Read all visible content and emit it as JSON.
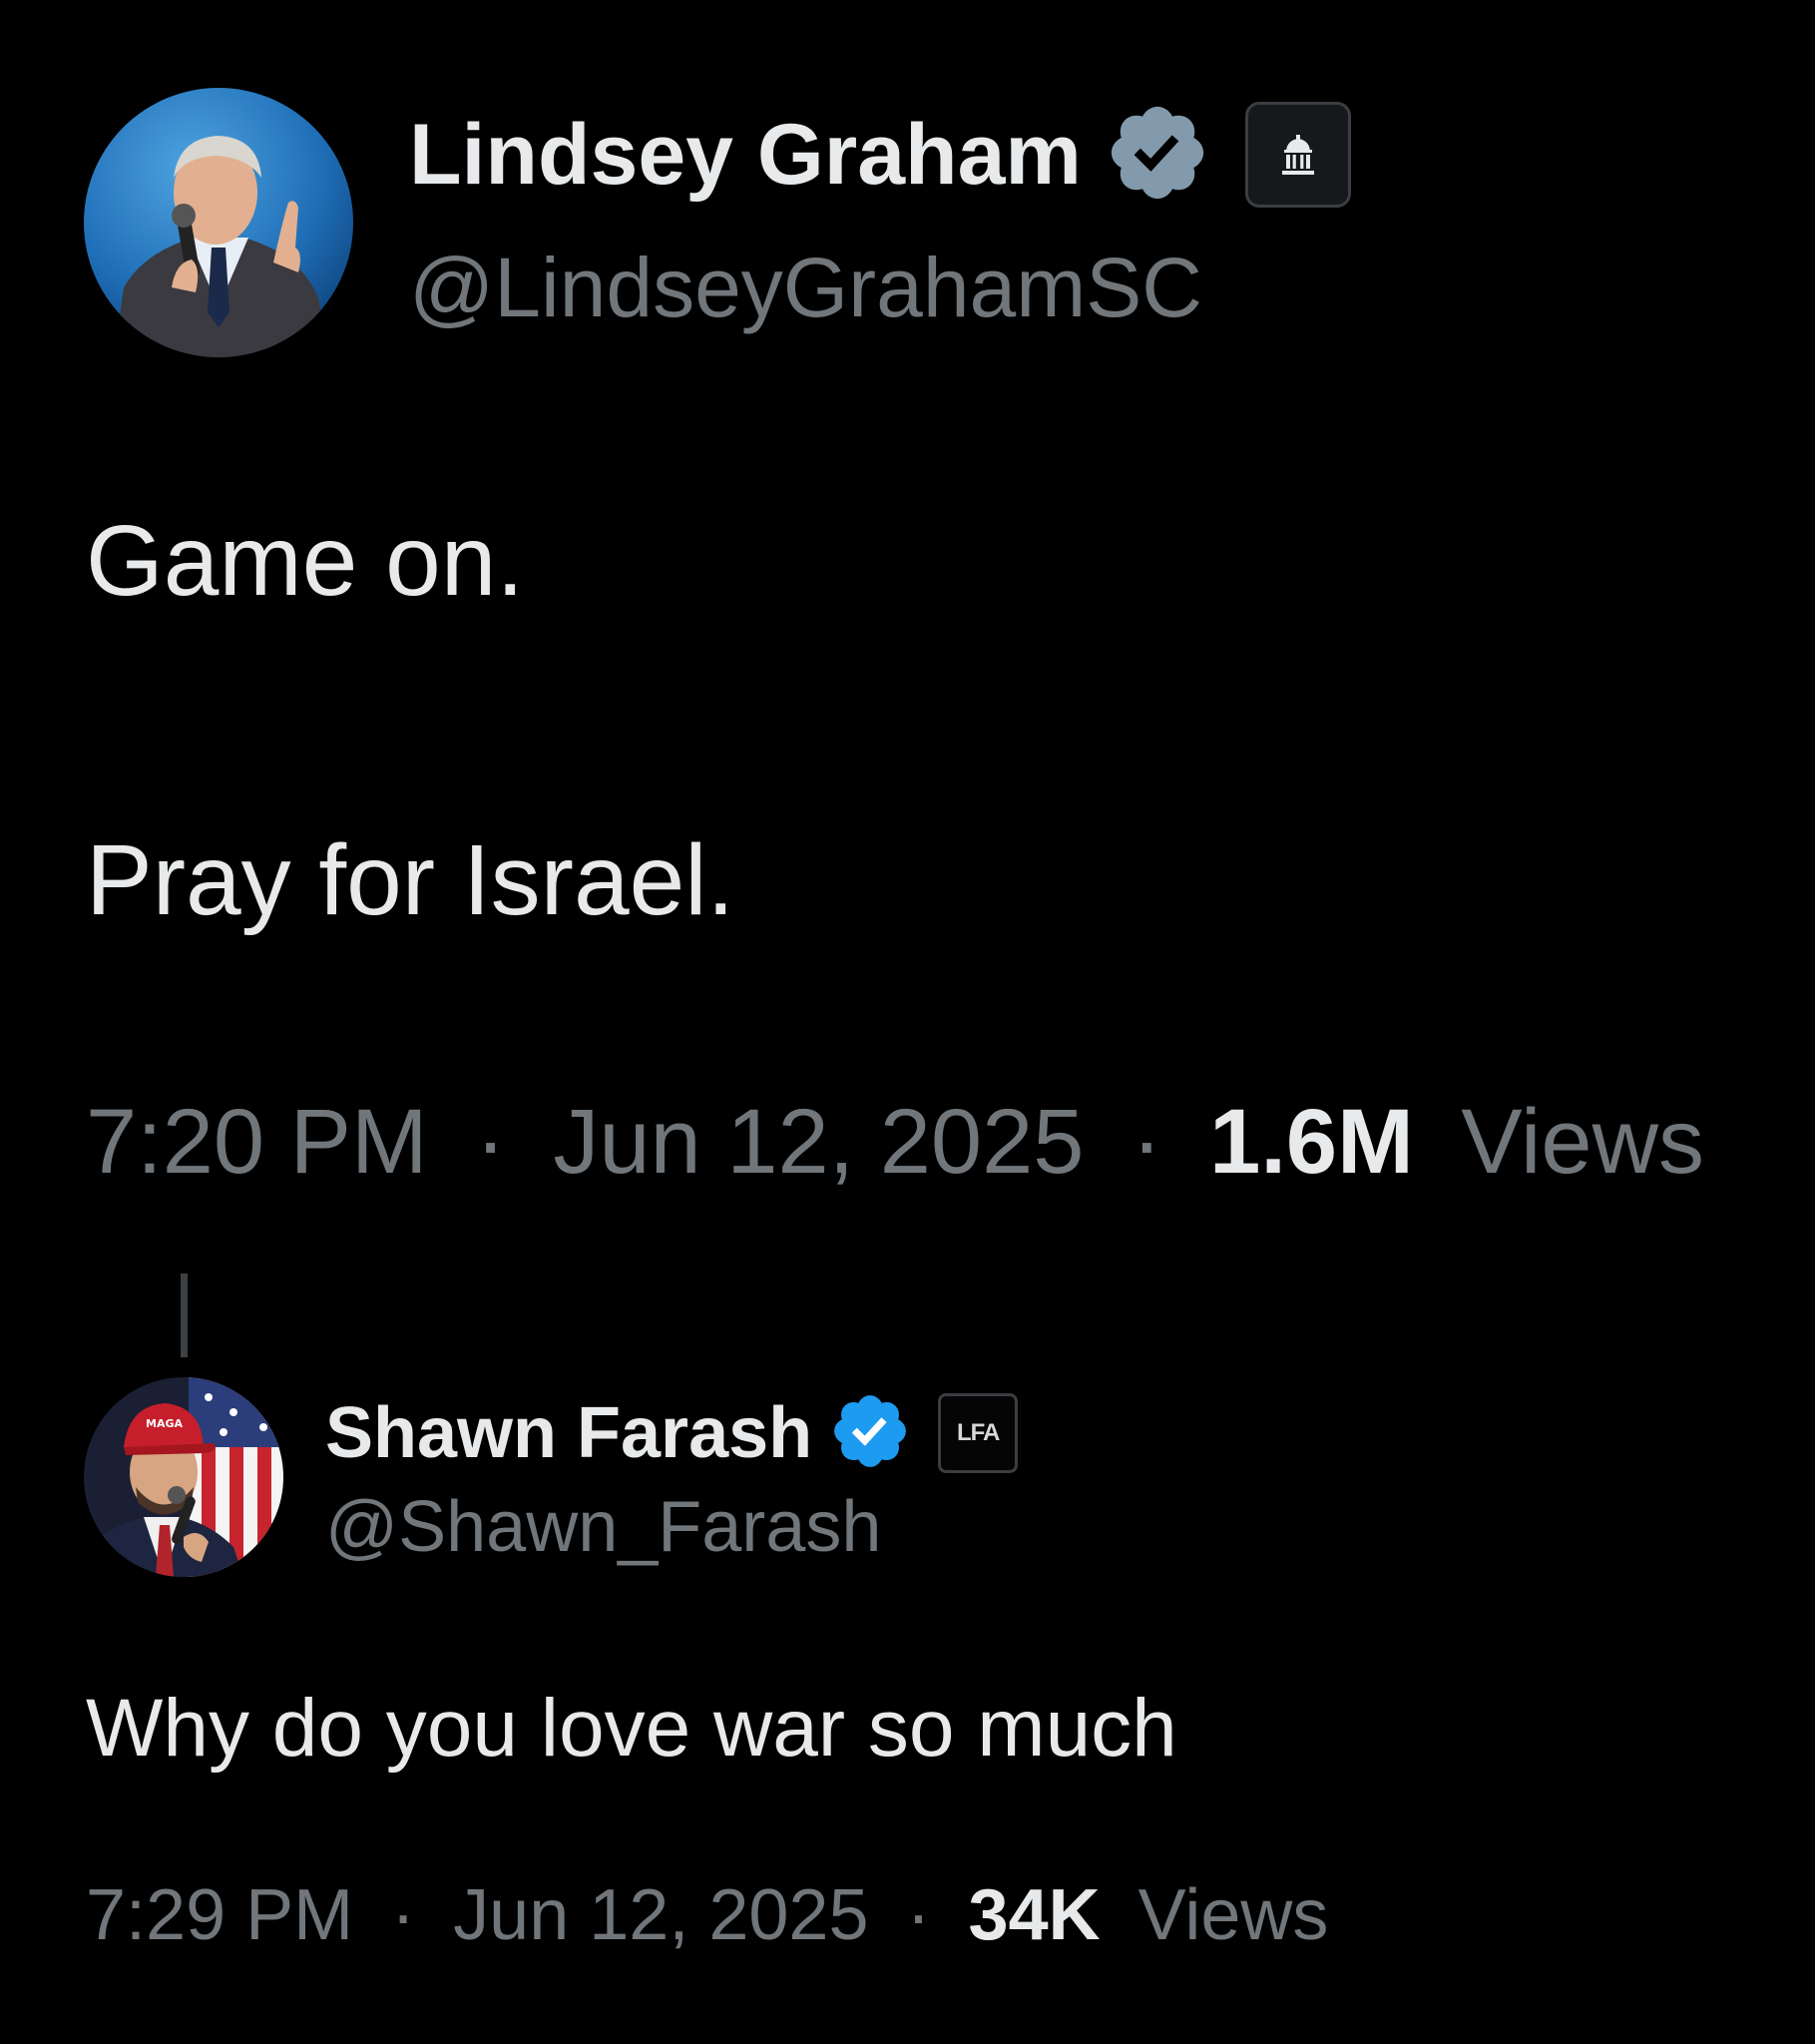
{
  "original_post": {
    "author": {
      "display_name": "Lindsey Graham",
      "handle": "@LindseyGrahamSC",
      "verified_badge_color": "#829aab",
      "affiliation_icon": "capitol-building-icon"
    },
    "text_lines": [
      "Game on.",
      "Pray for Israel."
    ],
    "time": "7:20 PM",
    "separator": "·",
    "date": "Jun 12, 2025",
    "views_count": "1.6M",
    "views_label": "Views"
  },
  "reply_post": {
    "author": {
      "display_name": "Shawn Farash",
      "handle": "@Shawn_Farash",
      "verified_badge_color": "#1d9bf0",
      "affiliation_label": "LFA"
    },
    "text": "Why do you love war so much",
    "time": "7:29 PM",
    "separator": "·",
    "date": "Jun 12, 2025",
    "views_count": "34K",
    "views_label": "Views"
  },
  "colors": {
    "background": "#000000",
    "primary_text": "#e7e9ea",
    "secondary_text": "#71767b"
  }
}
